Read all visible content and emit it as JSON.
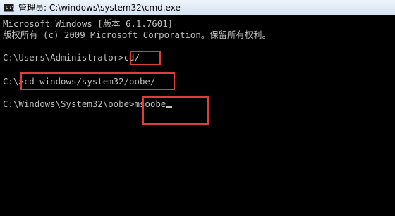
{
  "window": {
    "title": "管理员: C:\\windows\\system32\\cmd.exe",
    "icon": "cmd-icon",
    "icon_text": "C:\\"
  },
  "console": {
    "lines": [
      "Microsoft Windows [版本 6.1.7601]",
      "版权所有 (c) 2009 Microsoft Corporation。保留所有权利。",
      "",
      "C:\\Users\\Administrator>cd/",
      "",
      "C:\\>cd windows/system32/oobe/",
      "",
      "C:\\Windows\\System32\\oobe>msoobe"
    ]
  },
  "colors": {
    "console_bg": "#000000",
    "console_text": "#c0c0c0",
    "highlight_box": "#e03c3c"
  }
}
